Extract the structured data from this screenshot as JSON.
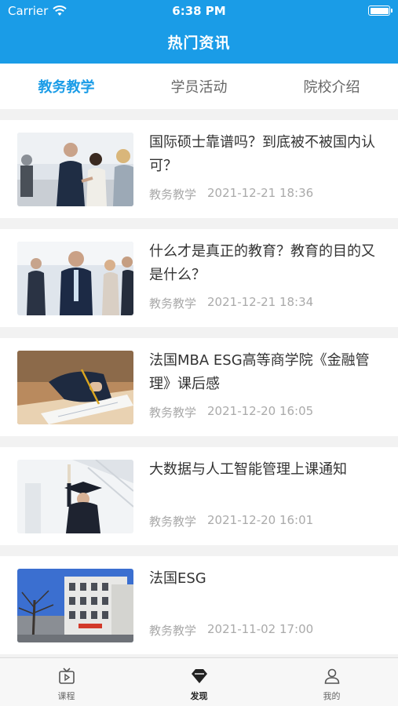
{
  "status_bar": {
    "carrier": "Carrier",
    "time": "6:38 PM"
  },
  "header": {
    "title": "热门资讯"
  },
  "tabs": [
    {
      "label": "教务教学",
      "active": true
    },
    {
      "label": "学员活动",
      "active": false
    },
    {
      "label": "院校介绍",
      "active": false
    }
  ],
  "articles": [
    {
      "title": "国际硕士靠谱吗？到底被不被国内认可？",
      "category": "教务教学",
      "date": "2021-12-21 18:36",
      "image": "handshake-photo"
    },
    {
      "title": "什么才是真正的教育？教育的目的又是什么？",
      "category": "教务教学",
      "date": "2021-12-21 18:34",
      "image": "business-team-photo"
    },
    {
      "title": "法国MBA ESG高等商学院《金融管理》课后感",
      "category": "教务教学",
      "date": "2021-12-20 16:05",
      "image": "writing-photo"
    },
    {
      "title": "大数据与人工智能管理上课通知",
      "category": "教务教学",
      "date": "2021-12-20 16:01",
      "image": "graduate-photo"
    },
    {
      "title": "法国ESG",
      "category": "教务教学",
      "date": "2021-11-02 17:00",
      "image": "school-building-photo"
    }
  ],
  "tabbar": [
    {
      "label": "课程",
      "icon": "play-screen-icon",
      "active": false
    },
    {
      "label": "发现",
      "icon": "diamond-icon",
      "active": true
    },
    {
      "label": "我的",
      "icon": "person-icon",
      "active": false
    }
  ],
  "colors": {
    "accent": "#1a9ce7",
    "background": "#f2f2f2"
  }
}
